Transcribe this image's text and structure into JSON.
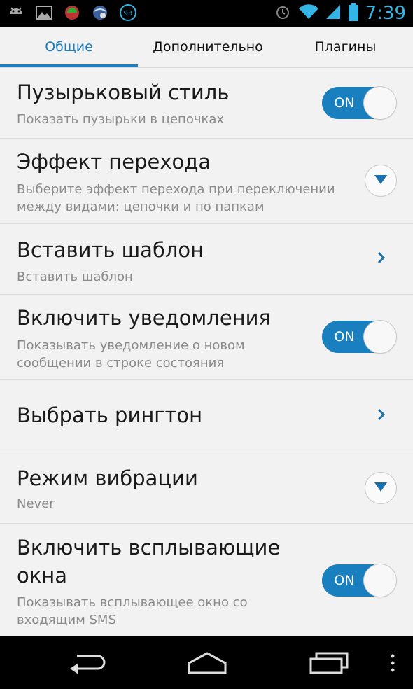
{
  "status_bar": {
    "time": "7:39",
    "battery_badge": "93",
    "icons": [
      "android-icon",
      "image-icon",
      "app-icon",
      "globe-icon",
      "badge-icon",
      "alarm-icon",
      "wifi-icon",
      "signal-icon",
      "battery-icon"
    ]
  },
  "tabs": [
    {
      "label": "Общие",
      "active": true
    },
    {
      "label": "Дополнительно",
      "active": false
    },
    {
      "label": "Плагины",
      "active": false
    }
  ],
  "settings": {
    "bubble_style": {
      "title": "Пузырьковый стиль",
      "subtitle": "Показать пузырьки в цепочках",
      "toggle": "ON"
    },
    "transition_effect": {
      "title": "Эффект перехода",
      "subtitle_line1": "Выберите эффект перехода при переключении",
      "subtitle_line2": "между видами: цепочки и по папкам"
    },
    "insert_template": {
      "title": "Вставить шаблон",
      "subtitle": "Вставить шаблон"
    },
    "notifications": {
      "title": "Включить уведомления",
      "subtitle_line1": "Показывать уведомление о новом",
      "subtitle_line2": "сообщении в строке состояния",
      "toggle": "ON"
    },
    "ringtone": {
      "title": "Выбрать рингтон"
    },
    "vibration": {
      "title": "Режим вибрации",
      "subtitle": "Never"
    },
    "popups": {
      "title_line1": "Включить всплывающие",
      "title_line2": "окна",
      "subtitle_line1": "Показывать всплывающее окно со",
      "subtitle_line2": "входящим SMS",
      "toggle": "ON"
    }
  },
  "colors": {
    "accent": "#1d7dbd",
    "toggle_on": "#1a7fbf",
    "clock": "#33b5e5"
  }
}
